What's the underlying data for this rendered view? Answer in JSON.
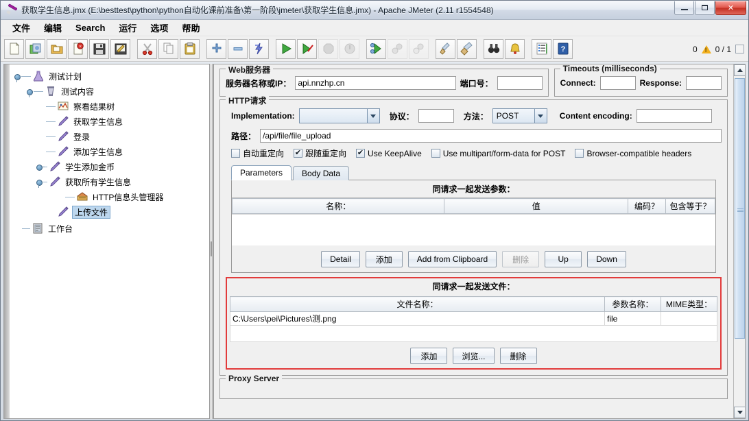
{
  "window": {
    "title": "获取学生信息.jmx (E:\\besttest\\python\\python自动化课前准备\\第一阶段\\jmeter\\获取学生信息.jmx) - Apache JMeter (2.11 r1554548)",
    "minimize_label": "Minimize",
    "maximize_label": "Maximize",
    "close_label": "✕"
  },
  "menubar": {
    "items": [
      {
        "label": "文件"
      },
      {
        "label": "编辑"
      },
      {
        "label": "Search"
      },
      {
        "label": "运行"
      },
      {
        "label": "选项"
      },
      {
        "label": "帮助"
      }
    ]
  },
  "toolbar": {
    "buttons": [
      {
        "icon": "new-document-icon",
        "title": "新建"
      },
      {
        "icon": "templates-icon",
        "title": "模板"
      },
      {
        "icon": "open-folder-icon",
        "title": "打开"
      },
      {
        "icon": "close-document-icon",
        "title": "关闭"
      },
      {
        "icon": "save-floppy-icon",
        "title": "保存"
      },
      {
        "icon": "save-as-icon",
        "title": "另存为"
      },
      {
        "icon": "cut-scissors-icon",
        "title": "剪切"
      },
      {
        "icon": "copy-pages-icon",
        "title": "复制"
      },
      {
        "icon": "paste-clipboard-icon",
        "title": "粘贴"
      },
      {
        "icon": "expand-plus-icon",
        "title": "展开全部"
      },
      {
        "icon": "collapse-minus-icon",
        "title": "折叠全部"
      },
      {
        "icon": "toggle-bolt-icon",
        "title": "切换"
      },
      {
        "icon": "run-play-icon",
        "title": "启动"
      },
      {
        "icon": "run-no-pause-icon",
        "title": "无间断启动"
      },
      {
        "icon": "stop-icon",
        "title": "停止",
        "disabled": true
      },
      {
        "icon": "shutdown-icon",
        "title": "关闭",
        "disabled": true
      },
      {
        "icon": "remote-start-icon",
        "title": "远程启动"
      },
      {
        "icon": "remote-stop-icon",
        "title": "远程停止",
        "disabled": true
      },
      {
        "icon": "remote-shutdown-icon",
        "title": "远程关闭",
        "disabled": true
      },
      {
        "icon": "clear-broom-icon",
        "title": "清除"
      },
      {
        "icon": "clear-all-broom-icon",
        "title": "清除全部"
      },
      {
        "icon": "search-binoculars-icon",
        "title": "查找"
      },
      {
        "icon": "reset-search-bell-icon",
        "title": "重置查找"
      },
      {
        "icon": "function-helper-icon",
        "title": "函数助手对话框"
      },
      {
        "icon": "help-book-icon",
        "title": "帮助"
      }
    ],
    "status": {
      "warning_count": "0",
      "warning_icon": "warning-triangle-icon",
      "threads": "0 / 1"
    }
  },
  "tree": {
    "nodes": [
      {
        "label": "测试计划",
        "icon": "test-plan-icon",
        "depth": 0,
        "handle": "expanded",
        "selected": false
      },
      {
        "label": "测试内容",
        "icon": "thread-group-icon",
        "depth": 1,
        "handle": "expanded",
        "selected": false
      },
      {
        "label": "察看结果树",
        "icon": "view-results-icon",
        "depth": 2,
        "handle": "none",
        "selected": false
      },
      {
        "label": "获取学生信息",
        "icon": "http-sampler-icon",
        "depth": 2,
        "handle": "none",
        "selected": false
      },
      {
        "label": "登录",
        "icon": "http-sampler-icon",
        "depth": 2,
        "handle": "none",
        "selected": false
      },
      {
        "label": "添加学生信息",
        "icon": "http-sampler-icon",
        "depth": 2,
        "handle": "none",
        "selected": false
      },
      {
        "label": "学生添加金币",
        "icon": "http-sampler-icon",
        "depth": 2,
        "handle": "collapsed",
        "selected": false
      },
      {
        "label": "获取所有学生信息",
        "icon": "http-sampler-icon",
        "depth": 2,
        "handle": "expanded",
        "selected": false
      },
      {
        "label": "HTTP信息头管理器",
        "icon": "header-manager-icon",
        "depth": 3,
        "handle": "none",
        "selected": false
      },
      {
        "label": "上传文件",
        "icon": "http-sampler-icon",
        "depth": 2,
        "handle": "none",
        "selected": true
      },
      {
        "label": "工作台",
        "icon": "workbench-icon",
        "depth": 0,
        "handle": "none",
        "selected": false
      }
    ]
  },
  "web_server": {
    "legend": "Web服务器",
    "server_label": "服务器名称或IP：",
    "server_value": "api.nnzhp.cn",
    "port_label": "端口号：",
    "port_value": ""
  },
  "timeouts": {
    "legend": "Timeouts (milliseconds)",
    "connect_label": "Connect:",
    "connect_value": "",
    "response_label": "Response:",
    "response_value": ""
  },
  "http_request": {
    "legend": "HTTP请求",
    "implementation_label": "Implementation:",
    "implementation_value": "",
    "protocol_label": "协议：",
    "protocol_value": "",
    "method_label": "方法：",
    "method_value": "POST",
    "content_encoding_label": "Content encoding:",
    "content_encoding_value": "",
    "path_label": "路径：",
    "path_value": "/api/file/file_upload",
    "checkboxes": [
      {
        "label": "自动重定向",
        "checked": false
      },
      {
        "label": "跟随重定向",
        "checked": true
      },
      {
        "label": "Use KeepAlive",
        "checked": true
      },
      {
        "label": "Use multipart/form-data for POST",
        "checked": false
      },
      {
        "label": "Browser-compatible headers",
        "checked": false
      }
    ]
  },
  "tabs": [
    {
      "label": "Parameters",
      "active": true
    },
    {
      "label": "Body Data",
      "active": false
    }
  ],
  "parameters_panel": {
    "caption": "同请求一起发送参数：",
    "columns": [
      "名称：",
      "值",
      "编码？",
      "包含等于？"
    ],
    "rows": [],
    "buttons": [
      {
        "label": "Detail",
        "disabled": false
      },
      {
        "label": "添加",
        "disabled": false
      },
      {
        "label": "Add from Clipboard",
        "disabled": false
      },
      {
        "label": "删除",
        "disabled": true
      },
      {
        "label": "Up",
        "disabled": false
      },
      {
        "label": "Down",
        "disabled": false
      }
    ]
  },
  "files_panel": {
    "caption": "同请求一起发送文件：",
    "columns": [
      "文件名称：",
      "参数名称：",
      "MIME类型："
    ],
    "rows": [
      {
        "filename": "C:\\Users\\pei\\Pictures\\测.png",
        "param": "file",
        "mime": ""
      }
    ],
    "buttons": [
      {
        "label": "添加",
        "disabled": false
      },
      {
        "label": "浏览...",
        "disabled": false
      },
      {
        "label": "删除",
        "disabled": false
      }
    ],
    "highlight_color": "#e23b3b"
  },
  "proxy_server": {
    "legend": "Proxy Server"
  }
}
